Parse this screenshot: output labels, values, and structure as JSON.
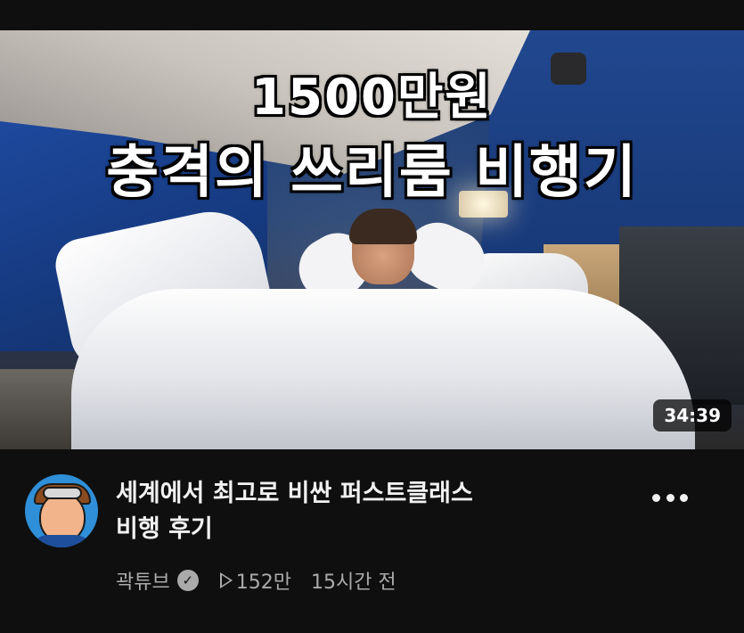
{
  "video": {
    "thumbnail": {
      "overlay_line1": "1500만원",
      "overlay_line2": "충격의 쓰리룸 비행기",
      "duration": "34:39"
    },
    "title_line1": "세계에서 최고로 비싼 퍼스트클래스",
    "title_line2": "비행 후기",
    "channel": "곽튜브",
    "verified_icon": "check-circle",
    "views": "152만",
    "published": "15시간 전"
  },
  "colors": {
    "background": "#0f0f0f",
    "primary_text": "#f1f1f1",
    "secondary_text": "#aaaaaa"
  }
}
